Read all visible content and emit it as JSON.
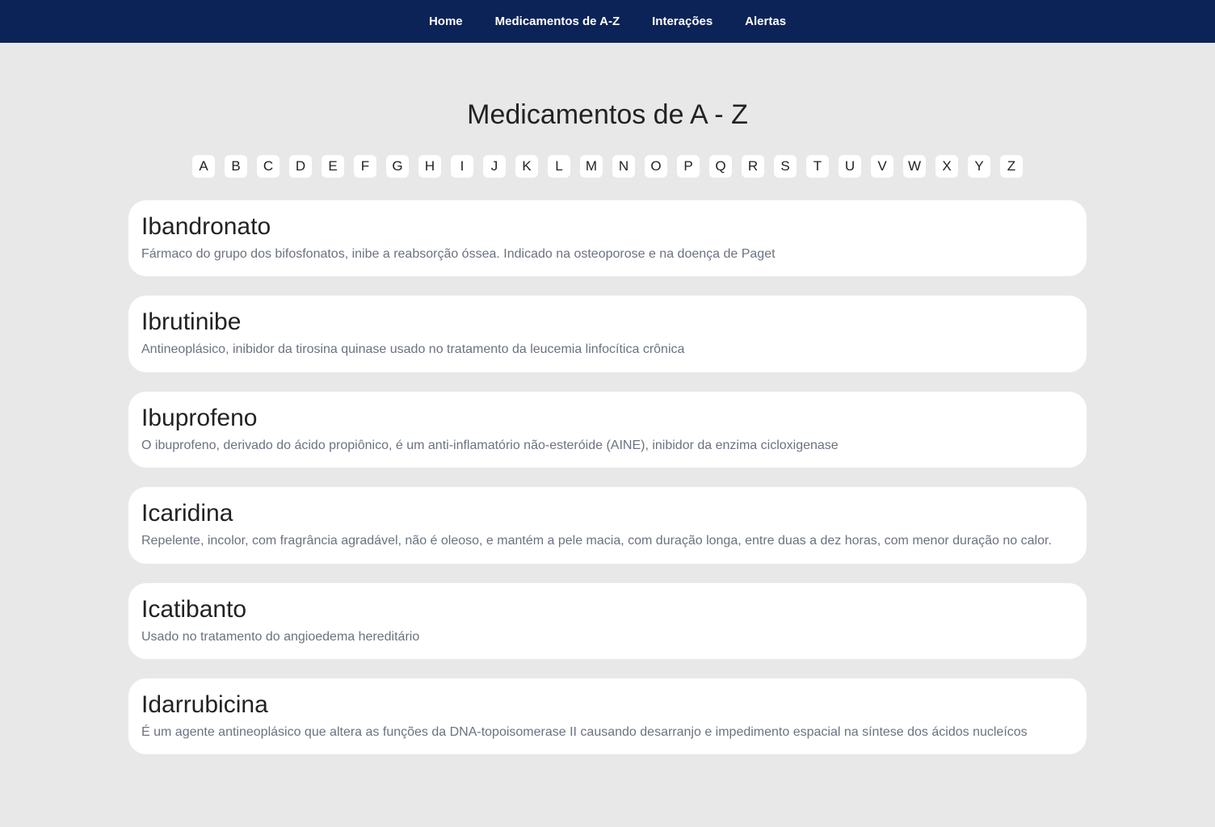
{
  "nav": {
    "items": [
      {
        "label": "Home"
      },
      {
        "label": "Medicamentos de A-Z"
      },
      {
        "label": "Interações"
      },
      {
        "label": "Alertas"
      }
    ]
  },
  "page": {
    "title": "Medicamentos de A - Z"
  },
  "alphabet": [
    "A",
    "B",
    "C",
    "D",
    "E",
    "F",
    "G",
    "H",
    "I",
    "J",
    "K",
    "L",
    "M",
    "N",
    "O",
    "P",
    "Q",
    "R",
    "S",
    "T",
    "U",
    "V",
    "W",
    "X",
    "Y",
    "Z"
  ],
  "medications": [
    {
      "name": "Ibandronato",
      "description": "Fármaco do grupo dos bifosfonatos, inibe a reabsorção óssea. Indicado na osteoporose e na doença de Paget"
    },
    {
      "name": "Ibrutinibe",
      "description": "Antineoplásico, inibidor da tirosina quinase usado no tratamento da leucemia linfocítica crônica"
    },
    {
      "name": "Ibuprofeno",
      "description": "O ibuprofeno, derivado do ácido propiônico, é um anti-inflamatório não-esteróide (AINE), inibidor da enzima cicloxigenase"
    },
    {
      "name": "Icaridina",
      "description": "Repelente, incolor, com fragrância agradável, não é oleoso, e mantém a pele macia, com duração longa, entre duas a dez horas, com menor duração no calor."
    },
    {
      "name": "Icatibanto",
      "description": "Usado no tratamento do angioedema hereditário"
    },
    {
      "name": "Idarrubicina",
      "description": "É um agente antineoplásico que altera as funções da DNA-topoisomerase II causando desarranjo e impedimento espacial na síntese dos ácidos nucleícos"
    }
  ]
}
